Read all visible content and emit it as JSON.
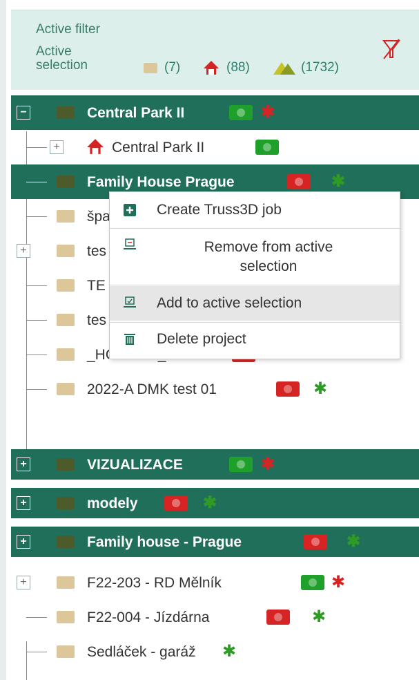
{
  "filter": {
    "active_filter_label": "Active filter",
    "active_selection_label": "Active\nselection",
    "folders_count": "(7)",
    "houses_count": "(88)",
    "items_count": "(1732)",
    "icons": [
      "folder-icon",
      "house-icon",
      "truss-icon",
      "filter-off-icon"
    ]
  },
  "tree": {
    "rows": [
      {
        "label": "Central Park II"
      },
      {
        "label": "Central Park II"
      },
      {
        "label": "Family House Prague"
      },
      {
        "label": "špa"
      },
      {
        "label": "tes"
      },
      {
        "label": "TE"
      },
      {
        "label": "tes"
      },
      {
        "label": "_HOTLINE_AS"
      },
      {
        "label": "2022-A DMK test 01"
      },
      {
        "label": "VIZUALIZACE"
      },
      {
        "label": "modely"
      },
      {
        "label": "Family house - Prague"
      },
      {
        "label": "F22-203 - RD Mělník"
      },
      {
        "label": "F22-004 - Jízdárna"
      },
      {
        "label": "Sedláček - garáž"
      }
    ]
  },
  "context_menu": {
    "create": "Create Truss3D job",
    "remove": "Remove from active\nselection",
    "add": "Add to active selection",
    "delete": "Delete project"
  },
  "colors": {
    "header_bg": "#dcefeb",
    "dark_row": "#1f6f5a",
    "green": "#1fa02a",
    "red": "#d62424"
  }
}
